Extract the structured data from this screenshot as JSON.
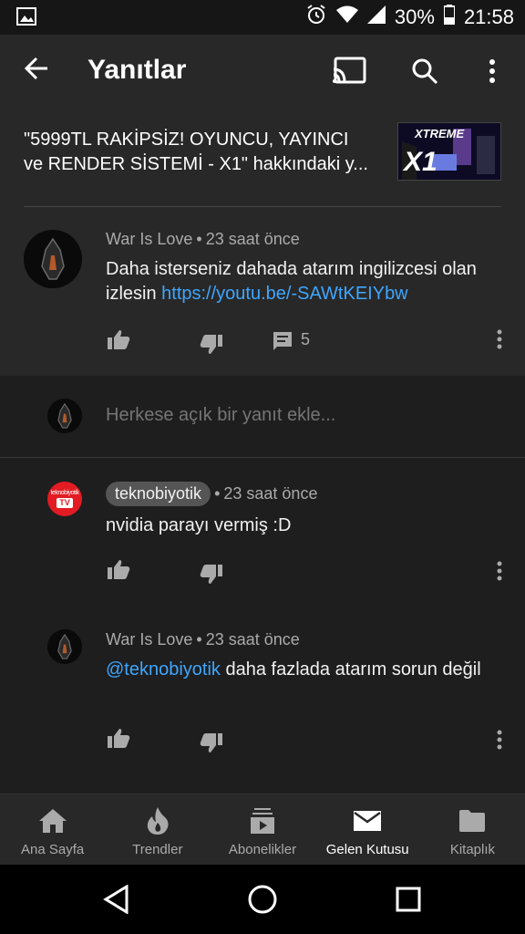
{
  "status_bar": {
    "battery": "30%",
    "time": "21:58"
  },
  "app_bar": {
    "title": "Yanıtlar",
    "icons": [
      "back-arrow-icon",
      "cast-icon",
      "search-icon",
      "more-vert-icon"
    ]
  },
  "video": {
    "title_line1": "\"5999TL RAKİPSİZ! OYUNCU, YAYINCI",
    "title_line2": "ve RENDER SİSTEMİ - X1\" hakkındaki y...",
    "thumb_text_top": "XTREME",
    "thumb_text_big": "X1"
  },
  "main_comment": {
    "author": "War Is Love",
    "time": "23 saat önce",
    "text": "Daha isterseniz dahada atarım ingilizcesi olan izlesin ",
    "link": "https://youtu.be/-SAWtKEIYbw",
    "reply_count": "5"
  },
  "reply_box": {
    "placeholder": "Herkese açık bir yanıt ekle..."
  },
  "replies": [
    {
      "author": "teknobiyotik",
      "time": "23 saat önce",
      "text": "nvidia parayı vermiş :D",
      "avatar_text": "teknobiyotik",
      "avatar_badge": "TV"
    },
    {
      "author": "War Is Love",
      "time": "23 saat önce",
      "mention": "@teknobiyotik",
      "text": " daha fazlada atarım sorun değil"
    }
  ],
  "bottom_nav": [
    {
      "label": "Ana Sayfa",
      "icon": "home-icon"
    },
    {
      "label": "Trendler",
      "icon": "flame-icon"
    },
    {
      "label": "Abonelikler",
      "icon": "subscriptions-icon"
    },
    {
      "label": "Gelen Kutusu",
      "icon": "mail-icon"
    },
    {
      "label": "Kitaplık",
      "icon": "folder-icon"
    }
  ],
  "colors": {
    "background": "#1e1e1e",
    "surface": "#282828",
    "link": "#3ea6ff",
    "secondary_text": "#aaaaaa"
  }
}
